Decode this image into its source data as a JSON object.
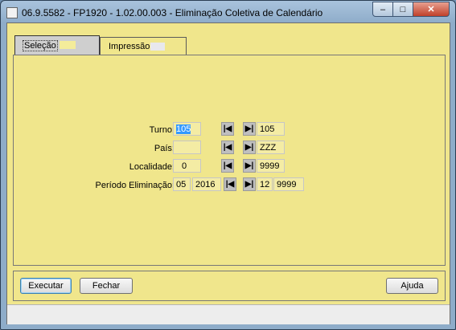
{
  "window": {
    "title": "06.9.5582 - FP1920 - 1.02.00.003 - Eliminação Coletiva de Calendário",
    "min_glyph": "–",
    "max_glyph": "□",
    "close_glyph": "✕"
  },
  "tabs": [
    {
      "label": "Seleção"
    },
    {
      "label": "Impressão"
    }
  ],
  "form": {
    "turno": {
      "label": "Turno:",
      "from": "105",
      "to": "105"
    },
    "pais": {
      "label": "País:",
      "from": "",
      "to": "ZZZ"
    },
    "localidade": {
      "label": "Localidade:",
      "from": "0",
      "to": "9999"
    },
    "periodo": {
      "label": "Período Eliminação:",
      "from_month": "05",
      "from_year": "2016",
      "to_month": "12",
      "to_year": "9999"
    }
  },
  "nav": {
    "first_glyph": "|◀",
    "last_glyph": "▶|"
  },
  "buttons": {
    "executar": "Executar",
    "fechar": "Fechar",
    "ajuda": "Ajuda"
  }
}
